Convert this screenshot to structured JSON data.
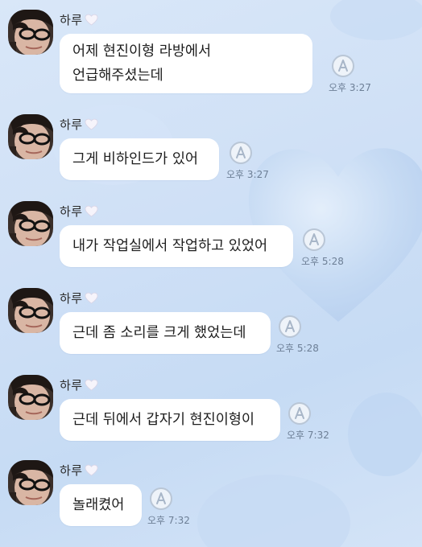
{
  "sender": {
    "name": "하루",
    "heart_icon": "white-heart-icon"
  },
  "messages": [
    {
      "text": "어제 현진이형 라방에서\n언급해주셨는데",
      "time": "오후 3:27"
    },
    {
      "text": "그게 비하인드가 있어",
      "time": "오후 3:27"
    },
    {
      "text": "내가 작업실에서 작업하고 있었어",
      "time": "오후 5:28"
    },
    {
      "text": "근데 좀 소리를 크게 했었는데",
      "time": "오후 5:28"
    },
    {
      "text": "근데 뒤에서 갑자기 현진이형이",
      "time": "오후 7:32"
    },
    {
      "text": "놀래켰어",
      "time": "오후 7:32"
    }
  ],
  "colors": {
    "background": "#cfe0f6",
    "bubble": "#ffffff",
    "time_text": "#6d7f96",
    "read_icon": "#b9c6d6"
  }
}
